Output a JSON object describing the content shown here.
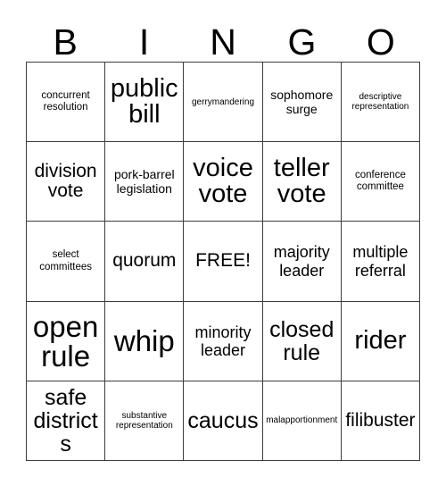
{
  "card": {
    "header_letters": [
      "B",
      "I",
      "N",
      "G",
      "O"
    ],
    "free_space_label": "FREE!",
    "colors": {
      "background": "#ffffff",
      "text": "#000000",
      "grid_line": "#3c3c3c"
    },
    "rows": [
      [
        {
          "text": "concurrent resolution",
          "size": "sm"
        },
        {
          "text": "public bill",
          "size": "3xl"
        },
        {
          "text": "gerrymandering",
          "size": "xs"
        },
        {
          "text": "sophomore surge",
          "size": "md"
        },
        {
          "text": "descriptive representation",
          "size": "xs"
        }
      ],
      [
        {
          "text": "division vote",
          "size": "xl"
        },
        {
          "text": "pork-barrel legislation",
          "size": "md"
        },
        {
          "text": "voice vote",
          "size": "3xl"
        },
        {
          "text": "teller vote",
          "size": "3xl"
        },
        {
          "text": "conference committee",
          "size": "sm"
        }
      ],
      [
        {
          "text": "select committees",
          "size": "sm"
        },
        {
          "text": "quorum",
          "size": "xl"
        },
        {
          "text": "FREE!",
          "size": "xl"
        },
        {
          "text": "majority leader",
          "size": "lg"
        },
        {
          "text": "multiple referral",
          "size": "lg"
        }
      ],
      [
        {
          "text": "open rule",
          "size": "4xl"
        },
        {
          "text": "whip",
          "size": "4xl"
        },
        {
          "text": "minority leader",
          "size": "lg"
        },
        {
          "text": "closed rule",
          "size": "2xl"
        },
        {
          "text": "rider",
          "size": "3xl"
        }
      ],
      [
        {
          "text": "safe districts",
          "size": "2xl"
        },
        {
          "text": "substantive representation",
          "size": "xs"
        },
        {
          "text": "caucus",
          "size": "2xl"
        },
        {
          "text": "malapportionment",
          "size": "xs"
        },
        {
          "text": "filibuster",
          "size": "xl"
        }
      ]
    ]
  }
}
